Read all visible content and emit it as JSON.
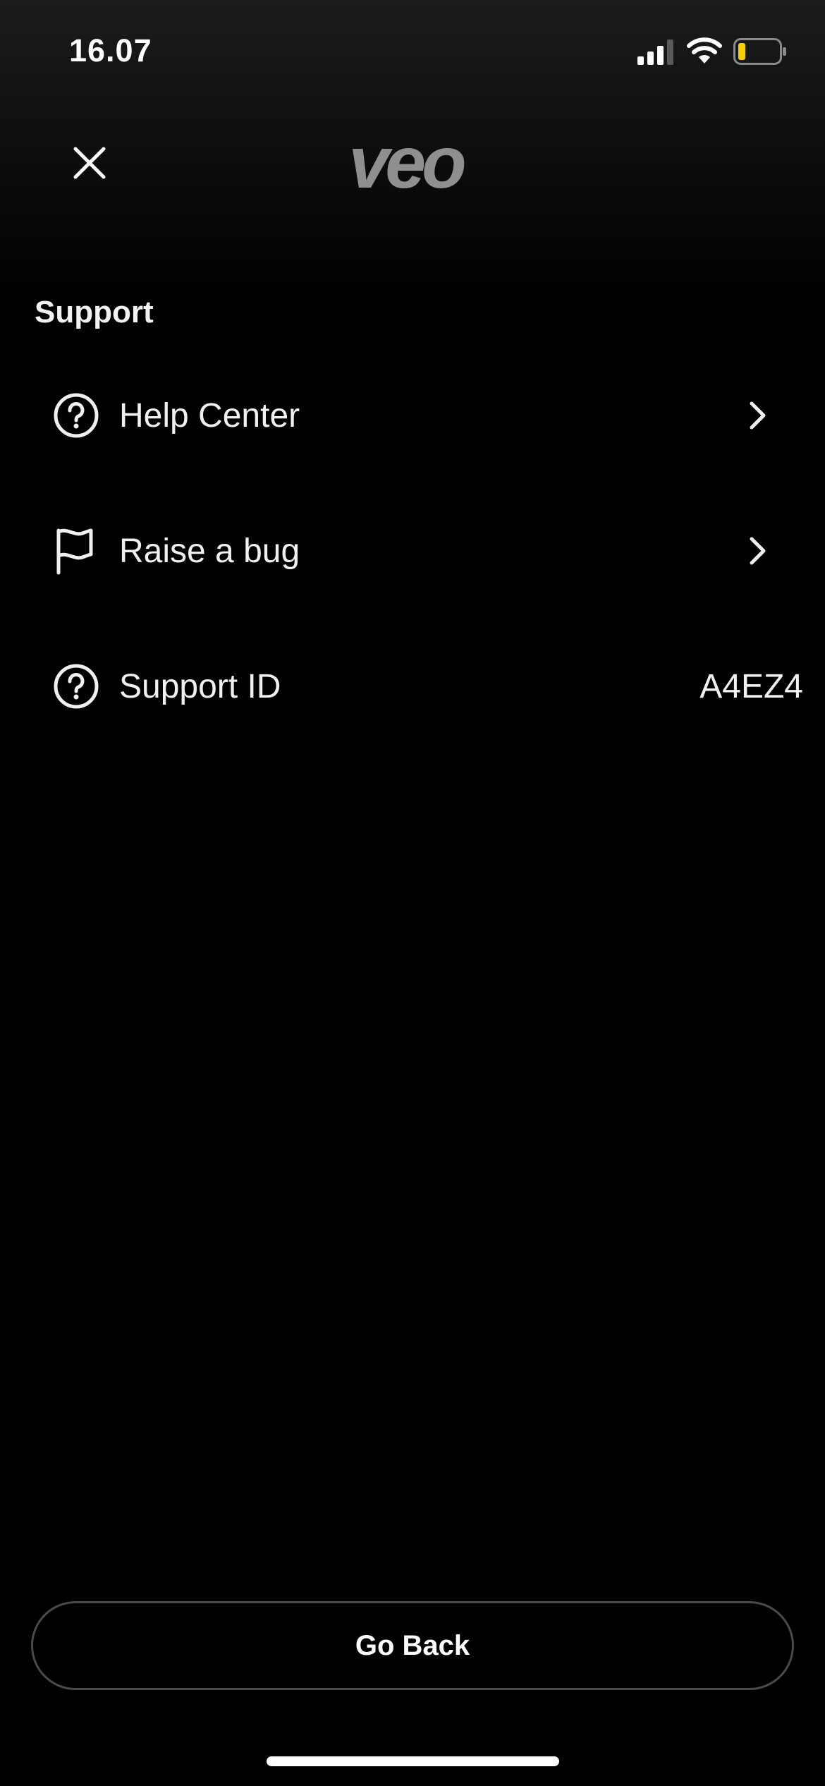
{
  "status_bar": {
    "time": "16.07",
    "icons": [
      "signal-icon",
      "wifi-icon",
      "battery-icon"
    ],
    "battery_color": "#f5d000"
  },
  "header": {
    "close_icon": "close-icon",
    "logo_text": "veo"
  },
  "support": {
    "section_title": "Support",
    "items": [
      {
        "icon": "help-circle-icon",
        "label": "Help Center",
        "chevron": "chevron-right-icon"
      },
      {
        "icon": "flag-icon",
        "label": "Raise a bug",
        "chevron": "chevron-right-icon"
      },
      {
        "icon": "help-circle-icon",
        "label": "Support ID",
        "value": "A4EZ4"
      }
    ]
  },
  "footer": {
    "go_back_label": "Go Back"
  },
  "colors": {
    "background": "#000000",
    "text": "#f2f2f2",
    "logo": "#8f8f8f",
    "button_border": "#4a4a4a"
  }
}
